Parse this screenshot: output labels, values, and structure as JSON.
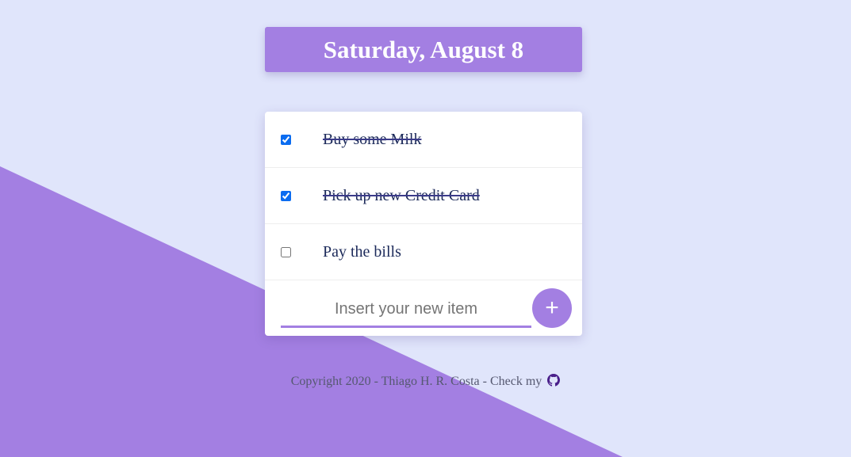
{
  "header": {
    "date_title": "Saturday, August 8"
  },
  "todo": {
    "items": [
      {
        "label": "Buy some Milk",
        "checked": true
      },
      {
        "label": "Pick up new Credit Card",
        "checked": true
      },
      {
        "label": "Pay the bills",
        "checked": false
      }
    ],
    "new_item_placeholder": "Insert your new item",
    "new_item_value": "",
    "add_button_label": "+"
  },
  "footer": {
    "text": "Copyright 2020 - Thiago H. R. Costa - Check my",
    "link_icon": "github-icon"
  },
  "colors": {
    "accent": "#a37fe2",
    "background": "#e0e5fb",
    "text": "#1c2a5a"
  }
}
